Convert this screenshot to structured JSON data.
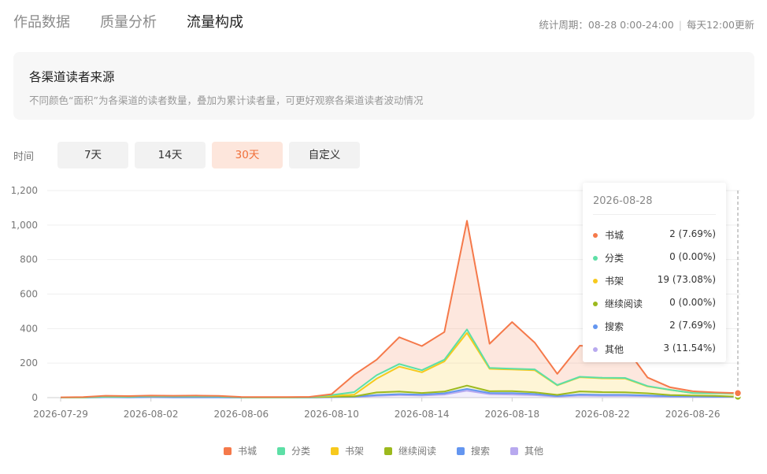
{
  "tabs": [
    {
      "label": "作品数据",
      "active": false
    },
    {
      "label": "质量分析",
      "active": false
    },
    {
      "label": "流量构成",
      "active": true
    }
  ],
  "period": {
    "label": "统计周期：08-28 0:00-24:00",
    "update": "每天12:00更新"
  },
  "info": {
    "title": "各渠道读者来源",
    "desc": "不同颜色“面积”为各渠道的读者数量，叠加为累计读者量，可更好观察各渠道读者波动情况"
  },
  "range": {
    "label": "时间",
    "buttons": [
      {
        "label": "7天",
        "active": false
      },
      {
        "label": "14天",
        "active": false
      },
      {
        "label": "30天",
        "active": true
      },
      {
        "label": "自定义",
        "active": false
      }
    ]
  },
  "tooltip": {
    "date": "2026-08-28",
    "rows": [
      {
        "name": "书城",
        "value": "2 (7.69%)",
        "color": "#f5794a"
      },
      {
        "name": "分类",
        "value": "0 (0.00%)",
        "color": "#5ddfa6"
      },
      {
        "name": "书架",
        "value": "19 (73.08%)",
        "color": "#f7c91d"
      },
      {
        "name": "继续阅读",
        "value": "0 (0.00%)",
        "color": "#9cb91d"
      },
      {
        "name": "搜索",
        "value": "2 (7.69%)",
        "color": "#6496f0"
      },
      {
        "name": "其他",
        "value": "3 (11.54%)",
        "color": "#b8a9ef"
      }
    ]
  },
  "chart_data": {
    "type": "area",
    "stacked": true,
    "ylim": [
      0,
      1200
    ],
    "y_ticks": [
      0,
      200,
      400,
      600,
      800,
      1000,
      1200
    ],
    "y_tick_labels": [
      "0",
      "200",
      "400",
      "600",
      "800",
      "1,000",
      "1,200"
    ],
    "x_tick_labels": [
      "2026-07-29",
      "2026-08-02",
      "2026-08-06",
      "2026-08-10",
      "2026-08-14",
      "2026-08-18",
      "2026-08-22",
      "2026-08-26"
    ],
    "x_tick_dates": [
      "07-29",
      "08-02",
      "08-06",
      "08-10",
      "08-14",
      "08-18",
      "08-22",
      "08-26"
    ],
    "x": [
      "07-29",
      "07-30",
      "07-31",
      "08-01",
      "08-02",
      "08-03",
      "08-04",
      "08-05",
      "08-06",
      "08-07",
      "08-08",
      "08-09",
      "08-10",
      "08-11",
      "08-12",
      "08-13",
      "08-14",
      "08-15",
      "08-16",
      "08-17",
      "08-18",
      "08-19",
      "08-20",
      "08-21",
      "08-22",
      "08-23",
      "08-24",
      "08-25",
      "08-26",
      "08-27",
      "08-28"
    ],
    "series": [
      {
        "name": "其他",
        "color": "#b8a9ef",
        "values": [
          0,
          0,
          2,
          1,
          2,
          1,
          1,
          1,
          0,
          0,
          0,
          0,
          2,
          3,
          10,
          15,
          12,
          18,
          40,
          20,
          18,
          14,
          6,
          12,
          10,
          10,
          8,
          5,
          4,
          3,
          3
        ]
      },
      {
        "name": "搜索",
        "color": "#6496f0",
        "values": [
          0,
          0,
          1,
          1,
          1,
          1,
          1,
          1,
          0,
          0,
          0,
          0,
          1,
          2,
          5,
          5,
          5,
          7,
          10,
          7,
          8,
          7,
          3,
          6,
          6,
          6,
          5,
          3,
          3,
          2,
          2
        ]
      },
      {
        "name": "继续阅读",
        "color": "#9cb91d",
        "values": [
          0,
          1,
          3,
          4,
          5,
          6,
          6,
          5,
          2,
          1,
          1,
          2,
          2,
          2,
          15,
          15,
          10,
          10,
          20,
          10,
          12,
          10,
          7,
          18,
          16,
          15,
          12,
          7,
          5,
          5,
          0
        ]
      },
      {
        "name": "书架",
        "color": "#f7c91d",
        "values": [
          0,
          0,
          0,
          0,
          0,
          0,
          0,
          0,
          0,
          0,
          0,
          0,
          5,
          10,
          80,
          145,
          120,
          175,
          305,
          130,
          125,
          128,
          55,
          82,
          80,
          80,
          40,
          30,
          15,
          15,
          19
        ]
      },
      {
        "name": "分类",
        "color": "#5ddfa6",
        "values": [
          0,
          0,
          0,
          0,
          0,
          0,
          0,
          0,
          0,
          0,
          0,
          0,
          5,
          15,
          20,
          15,
          12,
          10,
          20,
          5,
          5,
          5,
          2,
          3,
          3,
          3,
          2,
          0,
          0,
          0,
          0
        ]
      },
      {
        "name": "书城",
        "color": "#f5794a",
        "values": [
          2,
          2,
          5,
          3,
          4,
          3,
          4,
          3,
          2,
          2,
          2,
          2,
          5,
          100,
          90,
          155,
          140,
          160,
          630,
          140,
          270,
          155,
          65,
          180,
          178,
          180,
          50,
          15,
          10,
          5,
          2
        ]
      }
    ]
  }
}
